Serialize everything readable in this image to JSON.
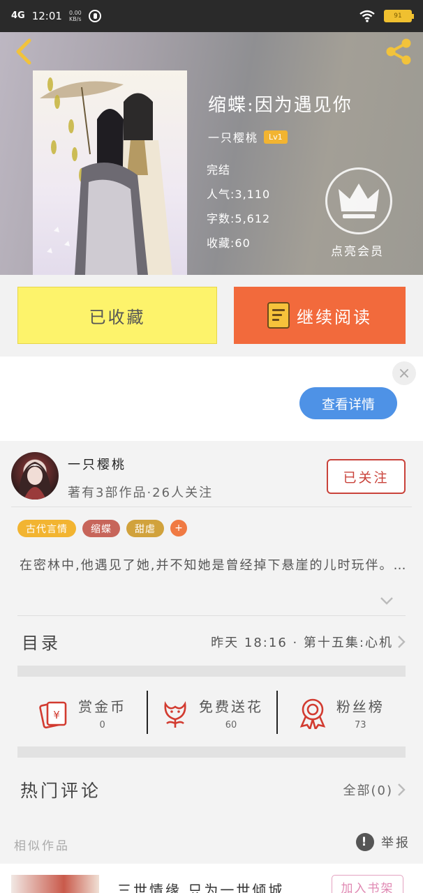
{
  "status_bar": {
    "network": "4G",
    "time": "12:01",
    "speed_value": "0.00",
    "speed_unit": "KB/s",
    "battery": "91"
  },
  "book": {
    "title": "缩蝶:因为遇见你",
    "author": "一只樱桃",
    "level": "Lv1",
    "status": "完结",
    "popularity": "人气:3,110",
    "word_count": "字数:5,612",
    "favorites": "收藏:60",
    "vip_label": "点亮会员"
  },
  "actions": {
    "favorited_label": "已收藏",
    "continue_label": "继续阅读"
  },
  "ad": {
    "close_glyph": "×",
    "details_label": "查看详情"
  },
  "author_card": {
    "name": "一只樱桃",
    "stats": "著有3部作品·26人关注",
    "follow_label": "已关注"
  },
  "tags": [
    {
      "label": "古代言情",
      "color": "#f2b431"
    },
    {
      "label": "缩蝶",
      "color": "#c7655a"
    },
    {
      "label": "甜虐",
      "color": "#d1a23c"
    }
  ],
  "tag_add": "+",
  "synopsis": "在密林中,他遇见了她,并不知她是曾经掉下悬崖的儿时玩伴。…",
  "toc": {
    "title": "目录",
    "latest": "昨天 18:16 · 第十五集:心机"
  },
  "support": [
    {
      "label": "赏金币",
      "value": "0",
      "icon": "red-envelope-icon"
    },
    {
      "label": "免费送花",
      "value": "60",
      "icon": "flower-icon"
    },
    {
      "label": "粉丝榜",
      "value": "73",
      "icon": "medal-icon"
    }
  ],
  "comments": {
    "title": "热门评论",
    "all_label": "全部(0)"
  },
  "similar": {
    "title": "相似作品",
    "report_label": "举报",
    "report_glyph": "!",
    "item_name": "三世情缘 只为一世倾城",
    "add_shelf_label": "加入书架"
  },
  "colors": {
    "favorite_button": "#fdf36b",
    "continue_button": "#f26a3c",
    "follow_accent": "#c9423a",
    "ad_button": "#4e92e6"
  }
}
